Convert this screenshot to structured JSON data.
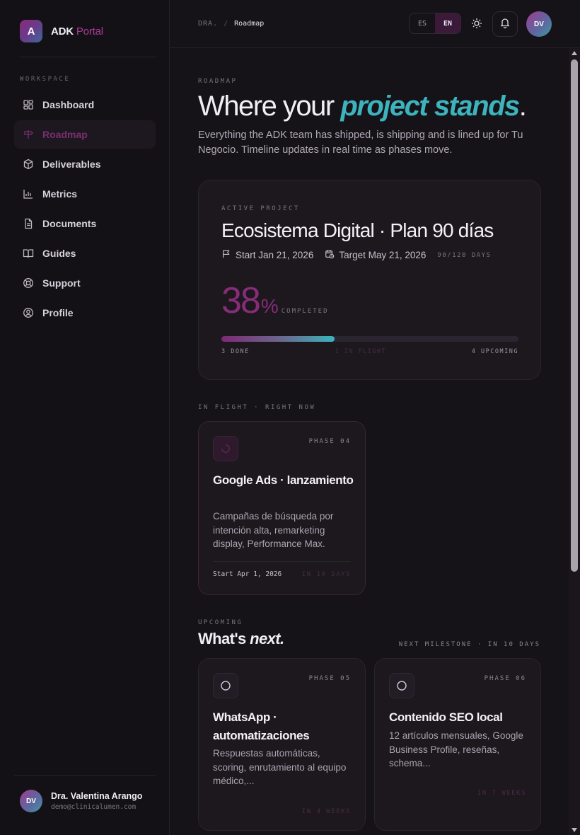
{
  "brand": {
    "name": "ADK",
    "accent": "Portal",
    "logo_letter": "A"
  },
  "sidebar": {
    "section_label": "WORKSPACE",
    "items": [
      {
        "label": "Dashboard",
        "icon": "grid-icon"
      },
      {
        "label": "Roadmap",
        "icon": "signpost-icon",
        "active": true
      },
      {
        "label": "Deliverables",
        "icon": "package-icon"
      },
      {
        "label": "Metrics",
        "icon": "bar-chart-icon"
      },
      {
        "label": "Documents",
        "icon": "file-text-icon"
      },
      {
        "label": "Guides",
        "icon": "book-icon"
      },
      {
        "label": "Support",
        "icon": "life-buoy-icon"
      },
      {
        "label": "Profile",
        "icon": "user-circle-icon"
      }
    ],
    "user": {
      "initials": "DV",
      "name": "Dra. Valentina Arango",
      "email": "demo@clinicalumen.com"
    }
  },
  "topbar": {
    "breadcrumb": {
      "root": "DRA.",
      "sep": "/",
      "current": "Roadmap"
    },
    "lang": {
      "es": "ES",
      "en": "EN",
      "active": "EN"
    },
    "avatar_initials": "DV"
  },
  "hero": {
    "eyebrow": "ROADMAP",
    "title_plain": "Where your ",
    "title_highlight": "project stands",
    "title_end": ".",
    "subtitle": "Everything the ADK team has shipped, is shipping and is lined up for Tu Negocio. Timeline updates in real time as phases move."
  },
  "active_project": {
    "eyebrow": "ACTIVE PROJECT",
    "title": "Ecosistema Digital · Plan 90 días",
    "start": "Start Jan 21, 2026",
    "target": "Target May 21, 2026",
    "days": "90/120 DAYS",
    "percent": "38",
    "percent_sign": "%",
    "percent_label": "COMPLETED",
    "progress_fraction": 0.38,
    "legend_done": "3 DONE",
    "legend_flight": "1 IN FLIGHT",
    "legend_upcoming": "4 UPCOMING"
  },
  "in_flight": {
    "eyebrow": "IN FLIGHT · RIGHT NOW",
    "card": {
      "phase": "PHASE 04",
      "title": "Google Ads · lanzamiento",
      "desc": "Campañas de búsqueda por intención alta, remarketing display, Performance Max.",
      "start": "Start Apr 1, 2026",
      "when": "IN 10 DAYS"
    }
  },
  "upcoming": {
    "eyebrow": "UPCOMING",
    "title_plain": "What's ",
    "title_italic": "next.",
    "next_milestone": "NEXT MILESTONE · IN 10 DAYS",
    "cards": [
      {
        "phase": "PHASE 05",
        "title": "WhatsApp · automatizaciones",
        "desc": "Respuestas automáticas, scoring, enrutamiento al equipo médico,...",
        "when": "IN 4 WEEKS"
      },
      {
        "phase": "PHASE 06",
        "title": "Contenido SEO local",
        "desc": "12 artículos mensuales, Google Business Profile, reseñas, schema...",
        "when": "IN 7 WEEKS"
      }
    ]
  },
  "colors": {
    "accent_magenta": "#862c78",
    "accent_teal": "#3db3bd",
    "background": "#151218"
  }
}
